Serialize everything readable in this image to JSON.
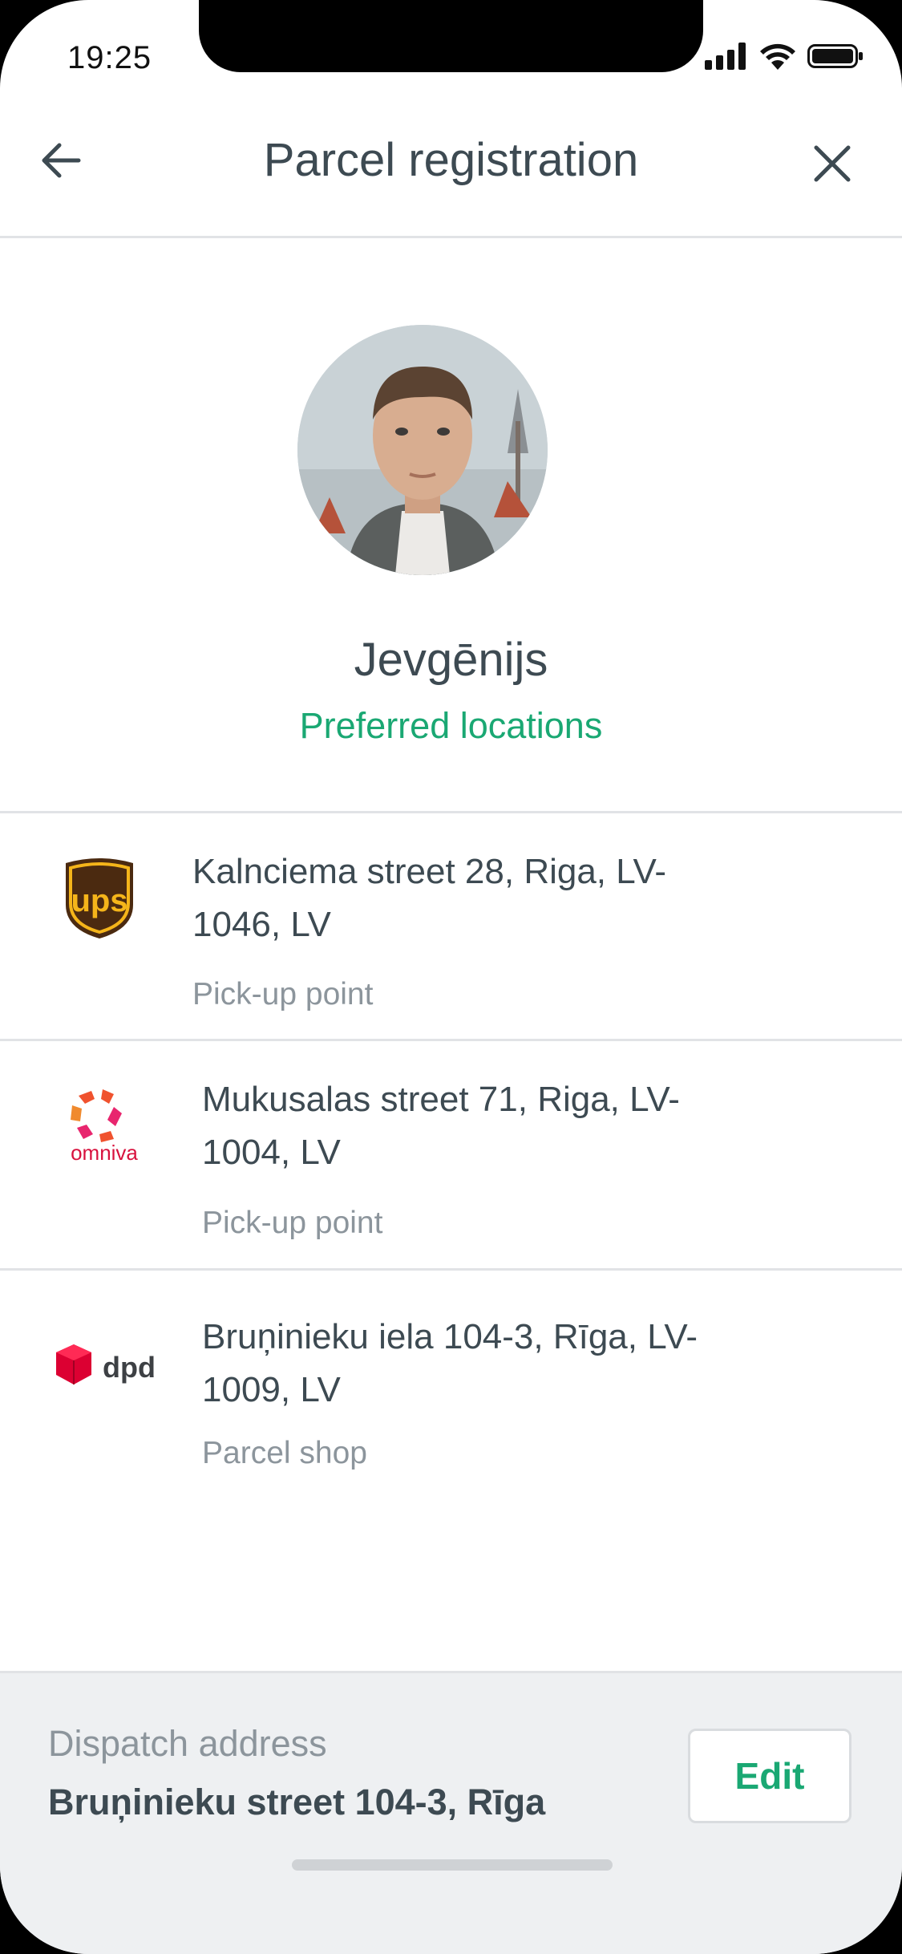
{
  "status_bar": {
    "time": "19:25"
  },
  "header": {
    "title": "Parcel registration",
    "back_icon": "arrow-left-icon",
    "close_icon": "close-icon"
  },
  "profile": {
    "name": "Jevgēnijs",
    "preferred_link": "Preferred locations"
  },
  "locations": [
    {
      "carrier": "ups",
      "address": "Kalnciema street 28, Riga, LV-1046, LV",
      "type": "Pick-up point"
    },
    {
      "carrier": "omniva",
      "address": "Mukusalas street 71, Riga, LV-1004, LV",
      "type": "Pick-up point"
    },
    {
      "carrier": "dpd",
      "address": "Bruņinieku iela 104-3, Rīga, LV-1009, LV",
      "type": "Parcel shop"
    }
  ],
  "footer": {
    "label": "Dispatch address",
    "value": "Bruņinieku street 104-3, Rīga",
    "edit_label": "Edit"
  },
  "colors": {
    "accent": "#1aa873",
    "text": "#3d4a52",
    "muted": "#8c959c"
  }
}
